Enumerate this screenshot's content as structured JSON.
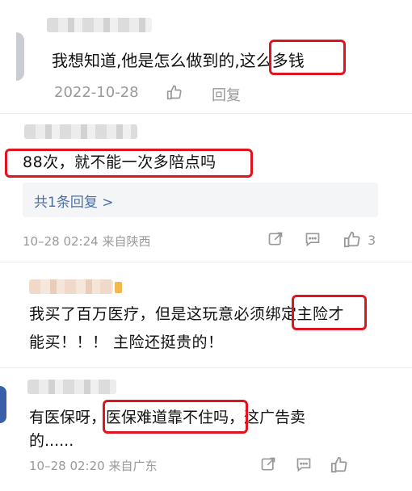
{
  "comments": [
    {
      "text_before": "我想知道,他是怎么做到的,",
      "highlight": "这么多钱",
      "date": "2022-10-28",
      "reply_label": "回复"
    },
    {
      "highlight": "88次，就不能一次多陪点吗",
      "replies_link": "共1条回复 >",
      "meta": "10–28 02:24 来自陕西",
      "likes": "3"
    },
    {
      "line1_before": "我买了百万医疗，但是这玩意必须",
      "highlight": "绑定主险",
      "line1_after": "才",
      "line2": "能买！！！ 主险还挺贵的！"
    },
    {
      "before": "有医保呀，",
      "highlight": "医保难道靠不住吗，",
      "after": "这广告卖",
      "line2": "的......",
      "meta": "10–28 02:20 来自广东"
    }
  ],
  "colors": {
    "highlight_border": "#e0141e",
    "link": "#4a6fa5",
    "meta": "#9a9a9a"
  },
  "icons": [
    "thumbs-up-icon",
    "share-icon",
    "comment-icon"
  ]
}
